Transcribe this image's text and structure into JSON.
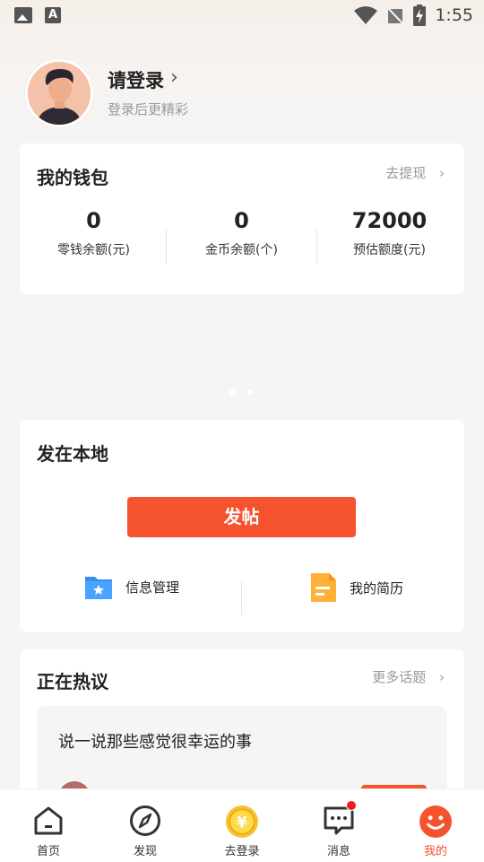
{
  "status_bar": {
    "time": "1:55"
  },
  "profile": {
    "title": "请登录",
    "subtitle": "登录后更精彩"
  },
  "wallet": {
    "title": "我的钱包",
    "link": "去提现",
    "items": [
      {
        "value": "0",
        "label": "零钱余额(元)"
      },
      {
        "value": "0",
        "label": "金币余额(个)"
      },
      {
        "value": "72000",
        "label": "预估额度(元)"
      }
    ]
  },
  "local": {
    "title": "发在本地",
    "post_button": "发帖",
    "items": [
      {
        "label": "信息管理"
      },
      {
        "label": "我的简历"
      }
    ]
  },
  "hot": {
    "title": "正在热议",
    "link": "更多话题",
    "topic": "说一说那些感觉很幸运的事"
  },
  "nav": {
    "items": [
      {
        "label": "首页",
        "icon": "home-icon"
      },
      {
        "label": "发现",
        "icon": "compass-icon"
      },
      {
        "label": "去登录",
        "icon": "coin-icon"
      },
      {
        "label": "消息",
        "icon": "message-icon"
      },
      {
        "label": "我的",
        "icon": "smile-icon"
      }
    ],
    "active_index": 4
  },
  "colors": {
    "accent": "#f5522e",
    "background": "#f5f5f5"
  }
}
